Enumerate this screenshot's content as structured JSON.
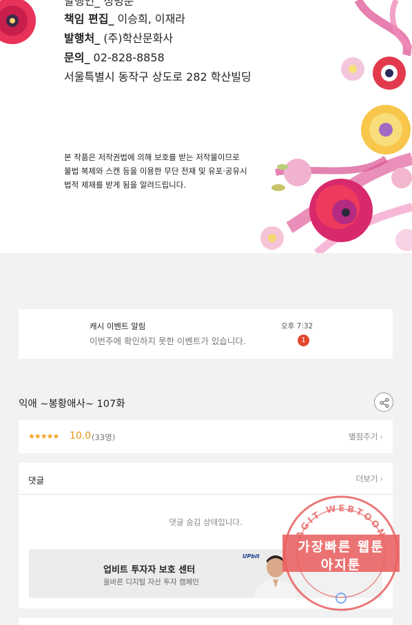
{
  "colophon": {
    "cut_line": "발행인_ 정병문",
    "editor_label": "책임 편집_",
    "editor_value": " 이승희, 이재라",
    "publisher_label": "발행처_",
    "publisher_value": " (주)학산문화사",
    "contact_label": "문의_",
    "contact_value": " 02-828-8858",
    "address": "서울특별시 동작구 상도로 282 학산빌딩",
    "notice": [
      "본 작품은 저작권법에 의해 보호를 받는 저작물이므로",
      "불법 복제와 스캔 등을 이용한 무단 전재 및 유포·공유시",
      "법적 제재를 받게 됨을 알려드립니다."
    ]
  },
  "notification": {
    "title": "캐시 이벤트 알림",
    "message": "이번주에 확인하지 못한 이벤트가 있습니다.",
    "time": "오후 7:32",
    "badge": "1"
  },
  "episode": {
    "title": "익애 ~봉황애사~ 107화",
    "share_icon": "share-icon"
  },
  "rating": {
    "stars_text": "★★★★★",
    "score": "10.0",
    "voters": "(33명)",
    "rate_label": "별점주기",
    "stars_value": 5,
    "star_color": "#f29e1d"
  },
  "comments": {
    "title": "댓글",
    "more_label": "더보기",
    "hidden_message": "댓글 숨김 상태입니다."
  },
  "ad": {
    "title": "업비트 투자자 보호 센터",
    "subtitle": "올바른 디지털 자산 투자 캠페인",
    "logo": "UPbit"
  },
  "watermark": {
    "line1": "가장빠른 웹툰",
    "line2": "아지툰",
    "ring_text": "AGIT WEBTOON",
    "color": "#e86060"
  }
}
